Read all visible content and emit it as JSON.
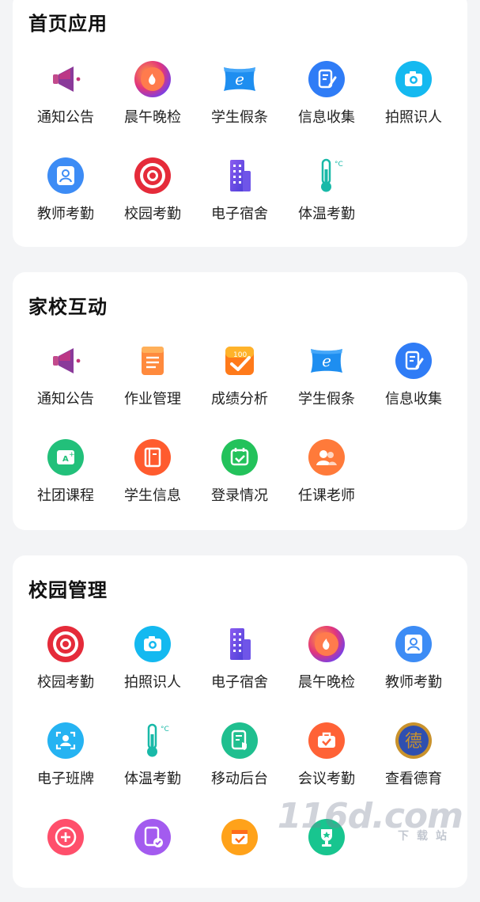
{
  "sections": [
    {
      "title": "首页应用",
      "items": [
        {
          "label": "通知公告",
          "icon": "megaphone-icon"
        },
        {
          "label": "晨午晚检",
          "icon": "flame-orb-icon"
        },
        {
          "label": "学生假条",
          "icon": "leave-note-icon"
        },
        {
          "label": "信息收集",
          "icon": "form-icon"
        },
        {
          "label": "拍照识人",
          "icon": "camera-icon"
        },
        {
          "label": "教师考勤",
          "icon": "teacher-id-icon"
        },
        {
          "label": "校园考勤",
          "icon": "target-icon"
        },
        {
          "label": "电子宿舍",
          "icon": "building-icon"
        },
        {
          "label": "体温考勤",
          "icon": "thermometer-icon"
        }
      ]
    },
    {
      "title": "家校互动",
      "items": [
        {
          "label": "通知公告",
          "icon": "megaphone-icon"
        },
        {
          "label": "作业管理",
          "icon": "notebook-icon"
        },
        {
          "label": "成绩分析",
          "icon": "score-100-icon"
        },
        {
          "label": "学生假条",
          "icon": "leave-note-icon"
        },
        {
          "label": "信息收集",
          "icon": "form-icon"
        },
        {
          "label": "社团课程",
          "icon": "grade-card-icon"
        },
        {
          "label": "学生信息",
          "icon": "book-icon"
        },
        {
          "label": "登录情况",
          "icon": "calendar-check-icon"
        },
        {
          "label": "任课老师",
          "icon": "people-icon"
        }
      ]
    },
    {
      "title": "校园管理",
      "items": [
        {
          "label": "校园考勤",
          "icon": "target-icon"
        },
        {
          "label": "拍照识人",
          "icon": "camera-icon"
        },
        {
          "label": "电子宿舍",
          "icon": "building-icon"
        },
        {
          "label": "晨午晚检",
          "icon": "flame-orb-icon"
        },
        {
          "label": "教师考勤",
          "icon": "teacher-id-icon"
        },
        {
          "label": "电子班牌",
          "icon": "face-scan-icon"
        },
        {
          "label": "体温考勤",
          "icon": "thermometer-icon"
        },
        {
          "label": "移动后台",
          "icon": "doc-shield-icon"
        },
        {
          "label": "会议考勤",
          "icon": "briefcase-check-icon"
        },
        {
          "label": "查看德育",
          "icon": "moral-badge-icon"
        },
        {
          "label": "",
          "icon": "plus-circle-icon"
        },
        {
          "label": "",
          "icon": "doc-check-icon"
        },
        {
          "label": "",
          "icon": "calendar-icon"
        },
        {
          "label": "",
          "icon": "trophy-icon"
        }
      ]
    }
  ],
  "moral_badge_char": "德",
  "watermark": {
    "text": "116d.com",
    "sub": "下载站"
  },
  "colors": {
    "megaphone": "#8a3a9a",
    "orange": "#ff6a2b",
    "blue": "#2f7cf6",
    "cyan": "#14b9f0",
    "red": "#e52b3a",
    "purple": "#6b4ee6",
    "green": "#22c07a",
    "teal": "#19b9a8",
    "gold": "#c9922c"
  }
}
